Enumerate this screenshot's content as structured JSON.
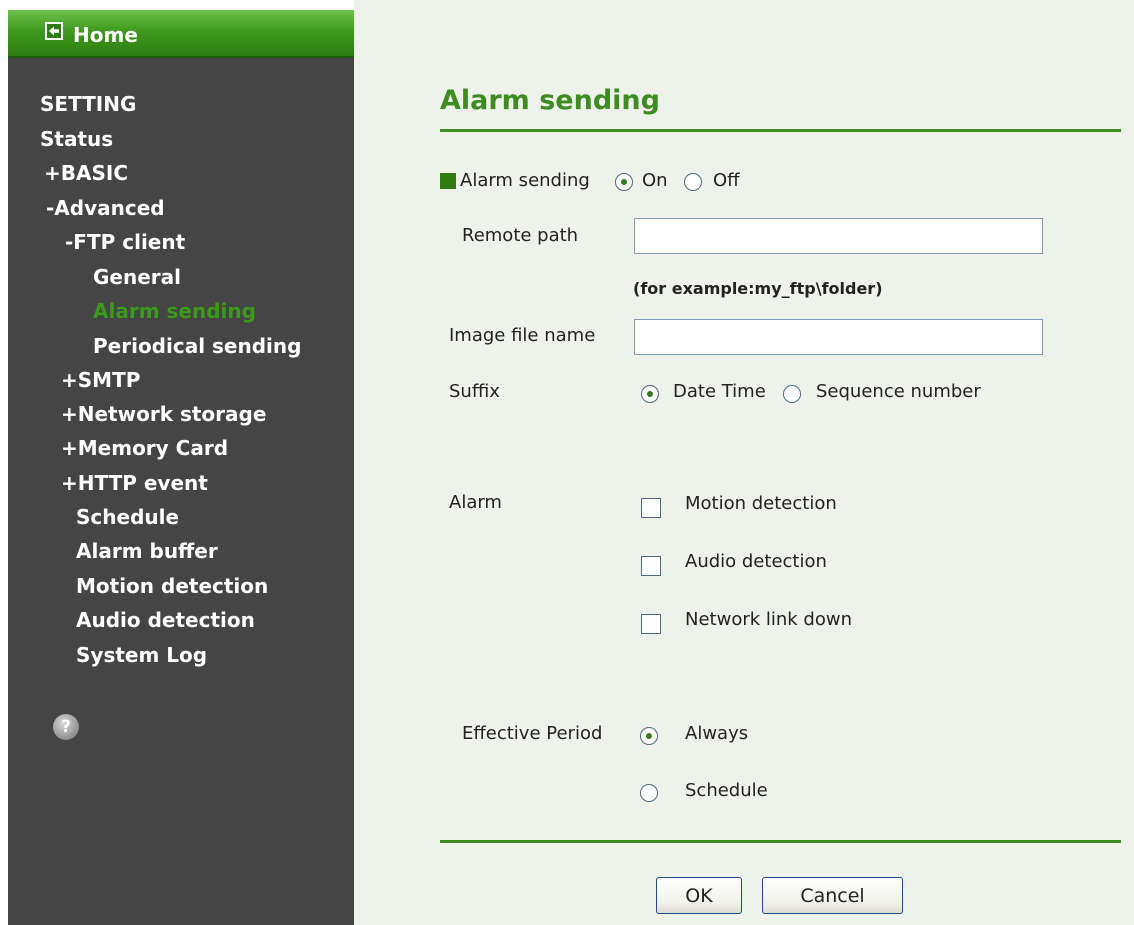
{
  "sidebar": {
    "home_label": "Home",
    "items": [
      {
        "label": "SETTING"
      },
      {
        "label": "Status"
      },
      {
        "label": "+BASIC"
      },
      {
        "label": "-Advanced"
      },
      {
        "label": "-FTP client"
      },
      {
        "label": "General"
      },
      {
        "label": "Alarm sending",
        "active": true
      },
      {
        "label": "Periodical sending"
      },
      {
        "label": "+SMTP"
      },
      {
        "label": "+Network storage"
      },
      {
        "label": "+Memory Card"
      },
      {
        "label": "+HTTP event"
      },
      {
        "label": "Schedule"
      },
      {
        "label": "Alarm buffer"
      },
      {
        "label": "Motion detection"
      },
      {
        "label": "Audio detection"
      },
      {
        "label": "System Log"
      }
    ],
    "help_icon_glyph": "?"
  },
  "main": {
    "title": "Alarm sending",
    "alarm_sending": {
      "label": "Alarm sending",
      "options": [
        "On",
        "Off"
      ],
      "selected": "On"
    },
    "remote_path": {
      "label": "Remote path",
      "value": "",
      "hint": "(for example:my_ftp\\folder)"
    },
    "image_file_name": {
      "label": "Image file name",
      "value": ""
    },
    "suffix": {
      "label": "Suffix",
      "options": [
        "Date Time",
        "Sequence number"
      ],
      "selected": "Date Time"
    },
    "alarm": {
      "label": "Alarm",
      "options": [
        {
          "label": "Motion detection",
          "checked": false
        },
        {
          "label": "Audio detection",
          "checked": false
        },
        {
          "label": "Network link down",
          "checked": false
        }
      ]
    },
    "effective_period": {
      "label": "Effective Period",
      "options": [
        "Always",
        "Schedule"
      ],
      "selected": "Always"
    },
    "buttons": {
      "ok": "OK",
      "cancel": "Cancel"
    }
  },
  "colors": {
    "accent_green": "#3c8c22",
    "sidebar_bg": "#454545",
    "main_bg": "#eef2ea",
    "active_nav": "#3a9a1a"
  }
}
